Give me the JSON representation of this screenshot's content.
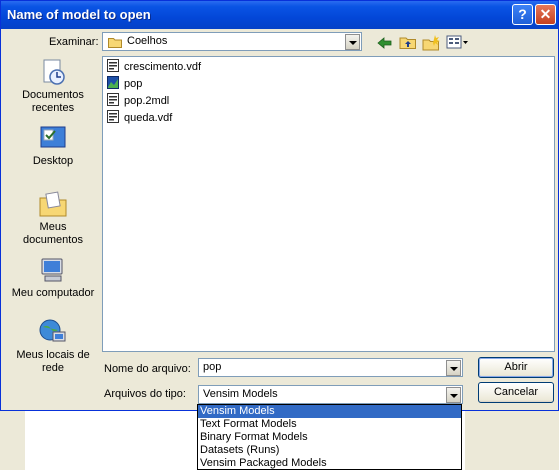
{
  "window": {
    "title": "Name of model to open"
  },
  "toolbar": {
    "look_in_label": "Examinar:",
    "look_in_value": "Coelhos"
  },
  "places": [
    {
      "label": "Documentos recentes",
      "icon": "recent-documents-icon"
    },
    {
      "label": "Desktop",
      "icon": "desktop-icon"
    },
    {
      "label": "Meus documentos",
      "icon": "my-documents-icon"
    },
    {
      "label": "Meu computador",
      "icon": "my-computer-icon"
    },
    {
      "label": "Meus locais de rede",
      "icon": "network-places-icon"
    }
  ],
  "files": [
    {
      "name": "crescimento.vdf",
      "icon": "vdf-file-icon"
    },
    {
      "name": "pop",
      "icon": "model-file-icon"
    },
    {
      "name": "pop.2mdl",
      "icon": "mdl-file-icon"
    },
    {
      "name": "queda.vdf",
      "icon": "vdf-file-icon"
    }
  ],
  "form": {
    "filename_label": "Nome do arquivo:",
    "filename_value": "pop",
    "filetype_label": "Arquivos do tipo:",
    "filetype_value": "Vensim Models",
    "open_button": "Abrir",
    "cancel_button": "Cancelar"
  },
  "filetype_options": [
    "Vensim Models",
    "Text Format Models",
    "Binary Format Models",
    "Datasets (Runs)",
    "Vensim Packaged Models"
  ]
}
